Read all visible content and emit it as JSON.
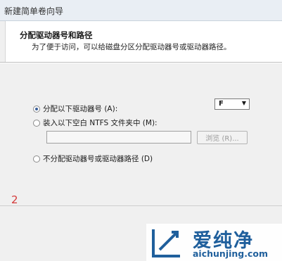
{
  "window": {
    "title": "新建简单卷向导"
  },
  "header": {
    "title": "分配驱动器号和路径",
    "description": "为了便于访问，可以给磁盘分区分配驱动器号或驱动器路径。"
  },
  "options": {
    "assign_letter": {
      "label": "分配以下驱动器号 (A):",
      "selected": true
    },
    "mount_folder": {
      "label": "装入以下空白 NTFS 文件夹中 (M):",
      "selected": false
    },
    "no_assign": {
      "label": "不分配驱动器号或驱动器路径 (D)",
      "selected": false
    }
  },
  "drive_select": {
    "value": "F"
  },
  "folder_path": {
    "value": "",
    "browse_label": "浏览 (R)..."
  },
  "annotation_number": "2",
  "watermark": {
    "name": "爱纯净",
    "url": "aichunjing.com",
    "accent": "#1f5f9c"
  },
  "colors": {
    "annotation": "#d43a3a",
    "radio_dot": "#3a5f9a"
  }
}
